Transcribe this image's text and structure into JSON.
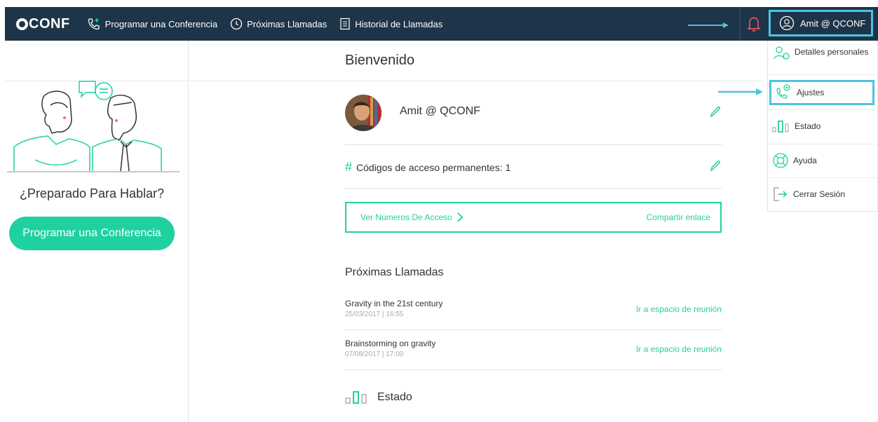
{
  "brand": {
    "logo_text": "CONF"
  },
  "nav": {
    "schedule_label": "Programar una Conferencia",
    "upcoming_label": "Próximas Llamadas",
    "history_label": "Historial de Llamadas"
  },
  "user": {
    "label": "Amit @ QCONF"
  },
  "sidebar": {
    "ready_text": "¿Preparado Para Hablar?",
    "cta_label": "Programar una Conferencia"
  },
  "main": {
    "welcome": "Bienvenido",
    "profile_name": "Amit @ QCONF",
    "codes_label": "Códigos de acceso permanentes: 1",
    "access_numbers_label": "Ver Números De Acceso",
    "share_label": "Compartir enlace",
    "upcoming_title": "Próximas Llamadas",
    "meetings": [
      {
        "name": "Gravity in the 21st century",
        "date": "25/03/2017 | 16:55",
        "action": "Ir a espacio de reunión"
      },
      {
        "name": "Brainstorming on gravity",
        "date": "07/08/2017 | 17:00",
        "action": "Ir a espacio de reunión"
      }
    ],
    "status_title": "Estado"
  },
  "menu": {
    "items": [
      {
        "label": "Detalles personales",
        "icon": "person-icon"
      },
      {
        "label": "Ajustes",
        "icon": "settings-icon"
      },
      {
        "label": "Estado",
        "icon": "status-bars-icon"
      },
      {
        "label": "Ayuda",
        "icon": "help-lifebuoy-icon"
      },
      {
        "label": "Cerrar Sesión",
        "icon": "logout-icon"
      }
    ]
  },
  "colors": {
    "accent": "#1fd1a1",
    "topbar": "#1e3448",
    "highlight": "#4fc3e1"
  }
}
